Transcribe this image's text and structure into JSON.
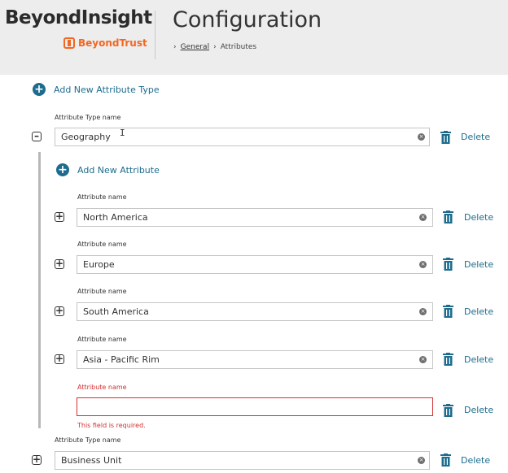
{
  "header": {
    "brand": "BeyondInsight",
    "sub_brand": "BeyondTrust",
    "title": "Configuration",
    "breadcrumb": {
      "separator": "›",
      "items": [
        "General",
        "Attributes"
      ]
    },
    "accent_color": "#f26722"
  },
  "main": {
    "add_type_label": "Add New Attribute Type",
    "add_attr_label": "Add New Attribute",
    "delete_label": "Delete",
    "type_name_label": "Attribute Type name",
    "attr_name_label": "Attribute name",
    "required_error": "This field is required.",
    "types": [
      {
        "value": "Geography",
        "expanded": true,
        "attributes": [
          {
            "value": "North America"
          },
          {
            "value": "Europe"
          },
          {
            "value": "South America"
          },
          {
            "value": "Asia - Pacific Rim"
          },
          {
            "value": ""
          }
        ]
      },
      {
        "value": "Business Unit",
        "expanded": false
      }
    ],
    "link_color": "#1d6c8e",
    "error_color": "#d32f2f"
  },
  "icons": {
    "collapse": "minus-square-icon",
    "expand": "plus-square-icon",
    "add": "plus-circle-icon",
    "clear": "clear-x-icon",
    "delete": "trash-icon",
    "logo": "beyondtrust-logo-icon"
  }
}
